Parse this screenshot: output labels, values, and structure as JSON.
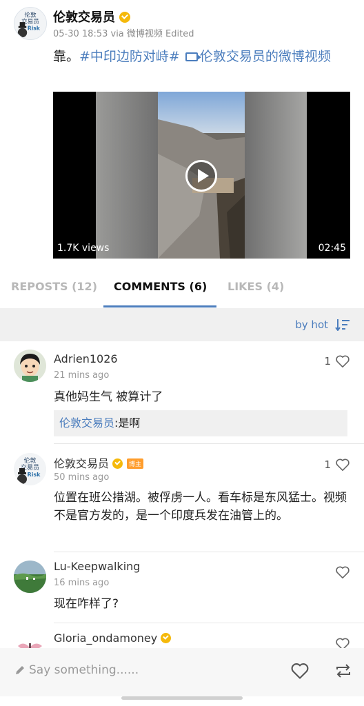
{
  "post": {
    "author": "伦敦交易员",
    "meta": "05-30 18:53 via 微博视频  Edited",
    "text_prefix": "靠。",
    "hashtag": "#中印边防对峙#",
    "video_link": "伦敦交易员的微博视频",
    "video": {
      "views": "1.7K views",
      "duration": "02:45"
    }
  },
  "tabs": [
    {
      "label": "REPOSTS (12)",
      "active": false
    },
    {
      "label": "COMMENTS (6)",
      "active": true
    },
    {
      "label": "LIKES (4)",
      "active": false
    }
  ],
  "sort": {
    "label": "by hot"
  },
  "comments": [
    {
      "name": "Adrien1026",
      "time": "21 mins ago",
      "text": "真他妈生气 被算计了",
      "likes": "1",
      "reply": {
        "name": "伦敦交易员",
        "text": ":是啊"
      }
    },
    {
      "name": "伦敦交易员",
      "badge": "博主",
      "time": "50 mins ago",
      "text": "位置在班公措湖。被俘虏一人。看车标是东风猛士。视频不是官方发的，是一个印度兵发在油管上的。",
      "likes": "1"
    },
    {
      "name": "Lu-Keepwalking",
      "time": "16 mins ago",
      "text": "现在咋样了?",
      "likes": ""
    },
    {
      "name": "Gloria_ondamoney",
      "time": "",
      "text": "",
      "likes": ""
    }
  ],
  "bottom_bar": {
    "placeholder": "Say something......"
  },
  "colors": {
    "link": "#4b7dbd",
    "verified": "#f5b90b",
    "badge": "#ff9d2c"
  }
}
